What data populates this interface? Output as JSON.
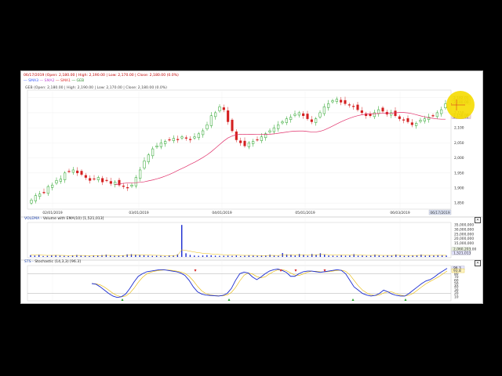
{
  "header": {
    "ohlc": "06/17/2019 (Open: 2,180.00 | High: 2,190.00 | Low: 2,170.00 | Close: 2,180.00 (0.0%)",
    "legend": [
      {
        "name": "SMA3",
        "color": "#3b5bff"
      },
      {
        "name": "SMA2",
        "color": "#c14fd6"
      },
      {
        "name": "SMA1",
        "color": "#e03030"
      },
      {
        "name": "GEB",
        "color": "#2a8a2a"
      }
    ],
    "series_info": "GEB (Open: 2,180.00 | High: 2,190.00 | Low: 2,170.00 | Close: 2,180.00 (0.0%)"
  },
  "volume_pane": {
    "title_prefix": "VOLEMA - ",
    "title_rest": "Volume with EMA(10) [1,521,013]"
  },
  "stoch_pane": {
    "title_prefix": "STS - ",
    "title_rest": "Stochastic (14,3,3) [96.3]"
  },
  "price_axis": {
    "ticks": [
      "2,200",
      "2,150",
      "2,100",
      "2,050",
      "2,000",
      "1,950",
      "1,900",
      "1,850"
    ],
    "badges": [
      "2,182.01",
      "2,180.00",
      "2,136.00",
      "2,150.00"
    ]
  },
  "date_axis": {
    "ticks": [
      "02/01/2019",
      "03/01/2019",
      "04/01/2019",
      "05/01/2019",
      "06/03/2019"
    ],
    "current": "06/17/2019"
  },
  "volume_axis": {
    "ticks": [
      "35,000,000",
      "30,000,000",
      "25,000,000",
      "20,000,000",
      "15,000,000"
    ],
    "badges": [
      "2,060,203.00",
      "1,521,013"
    ]
  },
  "stoch_axis": {
    "ticks": [
      "90",
      "80",
      "70",
      "60",
      "50",
      "40",
      "30",
      "20",
      "10"
    ],
    "badges": [
      "96.3",
      "93.8"
    ]
  },
  "colors": {
    "up": "#22a022",
    "down": "#d42020",
    "sma": "#e0306a",
    "volume": "#1a2bd0",
    "vol_ema": "#e8b800",
    "stoch_k": "#1a2bd0",
    "stoch_d": "#e8b800",
    "highlight": "#f5dc00"
  },
  "chart_data": {
    "type": "candlestick",
    "title": "GEB",
    "ylim": [
      1835,
      2220
    ],
    "candles_close": [
      1860,
      1875,
      1880,
      1885,
      1905,
      1910,
      1925,
      1930,
      1950,
      1955,
      1960,
      1950,
      1945,
      1935,
      1925,
      1930,
      1935,
      1920,
      1925,
      1915,
      1920,
      1910,
      1905,
      1900,
      1910,
      1935,
      1960,
      1990,
      2010,
      2030,
      2040,
      2050,
      2055,
      2060,
      2065,
      2060,
      2070,
      2065,
      2060,
      2070,
      2080,
      2090,
      2110,
      2140,
      2150,
      2170,
      2160,
      2120,
      2090,
      2060,
      2050,
      2040,
      2050,
      2055,
      2060,
      2070,
      2080,
      2090,
      2100,
      2110,
      2120,
      2130,
      2135,
      2145,
      2150,
      2140,
      2130,
      2120,
      2130,
      2150,
      2170,
      2180,
      2190,
      2195,
      2185,
      2180,
      2175,
      2170,
      2160,
      2150,
      2140,
      2140,
      2150,
      2160,
      2155,
      2145,
      2150,
      2140,
      2130,
      2125,
      2120,
      2110,
      2115,
      2125,
      2130,
      2135,
      2140,
      2150,
      2160,
      2180
    ],
    "volume_max": 36000000,
    "volume": [
      2,
      1.5,
      2.5,
      1,
      1.2,
      1.8,
      2,
      1.5,
      1.2,
      1,
      1.6,
      2.2,
      1.5,
      1.3,
      1,
      1.4,
      1.6,
      2,
      2.5,
      1.5,
      1.2,
      1.3,
      1.6,
      2.8,
      3,
      2.5,
      2.2,
      2,
      1.5,
      1.2,
      1.4,
      1.2,
      1,
      1.6,
      1.5,
      2.8,
      35,
      4,
      2.2,
      1.5,
      1.2,
      1.6,
      2,
      1.8,
      1.4,
      1.2,
      1.3,
      1.5,
      1.2,
      1.6,
      1,
      1.4,
      1.8,
      1.5,
      1.2,
      1.3,
      1.4,
      2.5,
      1.6,
      1.2,
      4.2,
      2.8,
      2.5,
      1.6,
      3.2,
      2.2,
      1.4,
      3.2,
      2.4,
      4,
      2.6,
      1.6,
      1.4,
      1.2,
      2,
      1.4,
      1.6,
      3,
      1.4,
      1.6,
      1.2,
      1.4,
      2.6,
      1.6,
      1.2,
      1.8,
      1.5,
      2.6,
      1.6,
      1.2,
      1.4,
      1.6,
      1.8,
      2.6,
      1.5,
      1.8,
      1.6,
      2,
      1.8,
      1.5
    ],
    "stoch_k": [
      50,
      48,
      40,
      30,
      20,
      12,
      8,
      10,
      18,
      35,
      55,
      72,
      80,
      86,
      88,
      90,
      92,
      92,
      90,
      88,
      86,
      82,
      75,
      60,
      40,
      25,
      18,
      15,
      14,
      13,
      12,
      14,
      20,
      35,
      60,
      80,
      85,
      82,
      70,
      62,
      70,
      80,
      88,
      92,
      94,
      90,
      84,
      72,
      72,
      80,
      86,
      88,
      88,
      86,
      84,
      86,
      88,
      90,
      92,
      90,
      80,
      60,
      40,
      30,
      20,
      15,
      12,
      14,
      20,
      30,
      25,
      18,
      14,
      12,
      12,
      20,
      30,
      40,
      50,
      58,
      62,
      70,
      80,
      88,
      96
    ]
  }
}
